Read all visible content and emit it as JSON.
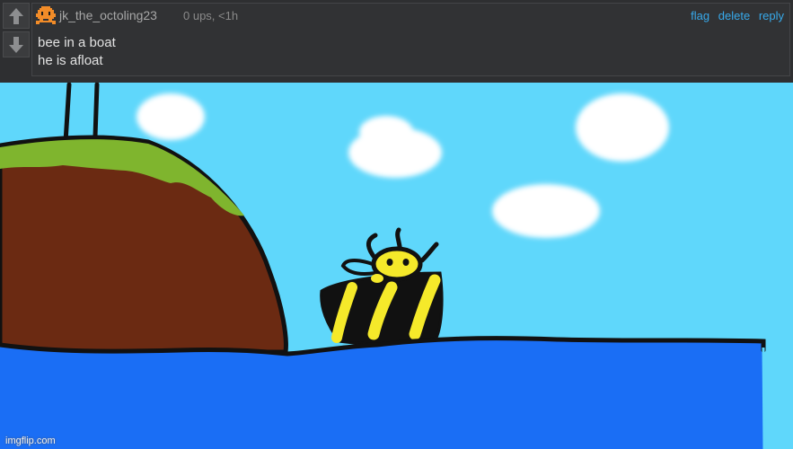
{
  "comment": {
    "username": "jk_the_octoling23",
    "meta": "0 ups, <1h",
    "actions": {
      "flag": "flag",
      "delete": "delete",
      "reply": "reply"
    },
    "text_line1": "bee in a boat",
    "text_line2": "he is afloat"
  },
  "icons": {
    "upvote": "up-arrow-icon",
    "downvote": "down-arrow-icon",
    "avatar": "pixel-octoling-icon"
  },
  "colors": {
    "sky": "#5fd7fb",
    "water": "#1a6ef5",
    "hill": "#6b2a12",
    "grass": "#7fb52e",
    "link": "#37a9ea",
    "avatar": "#f28c28"
  },
  "watermark": "imgflip.com"
}
